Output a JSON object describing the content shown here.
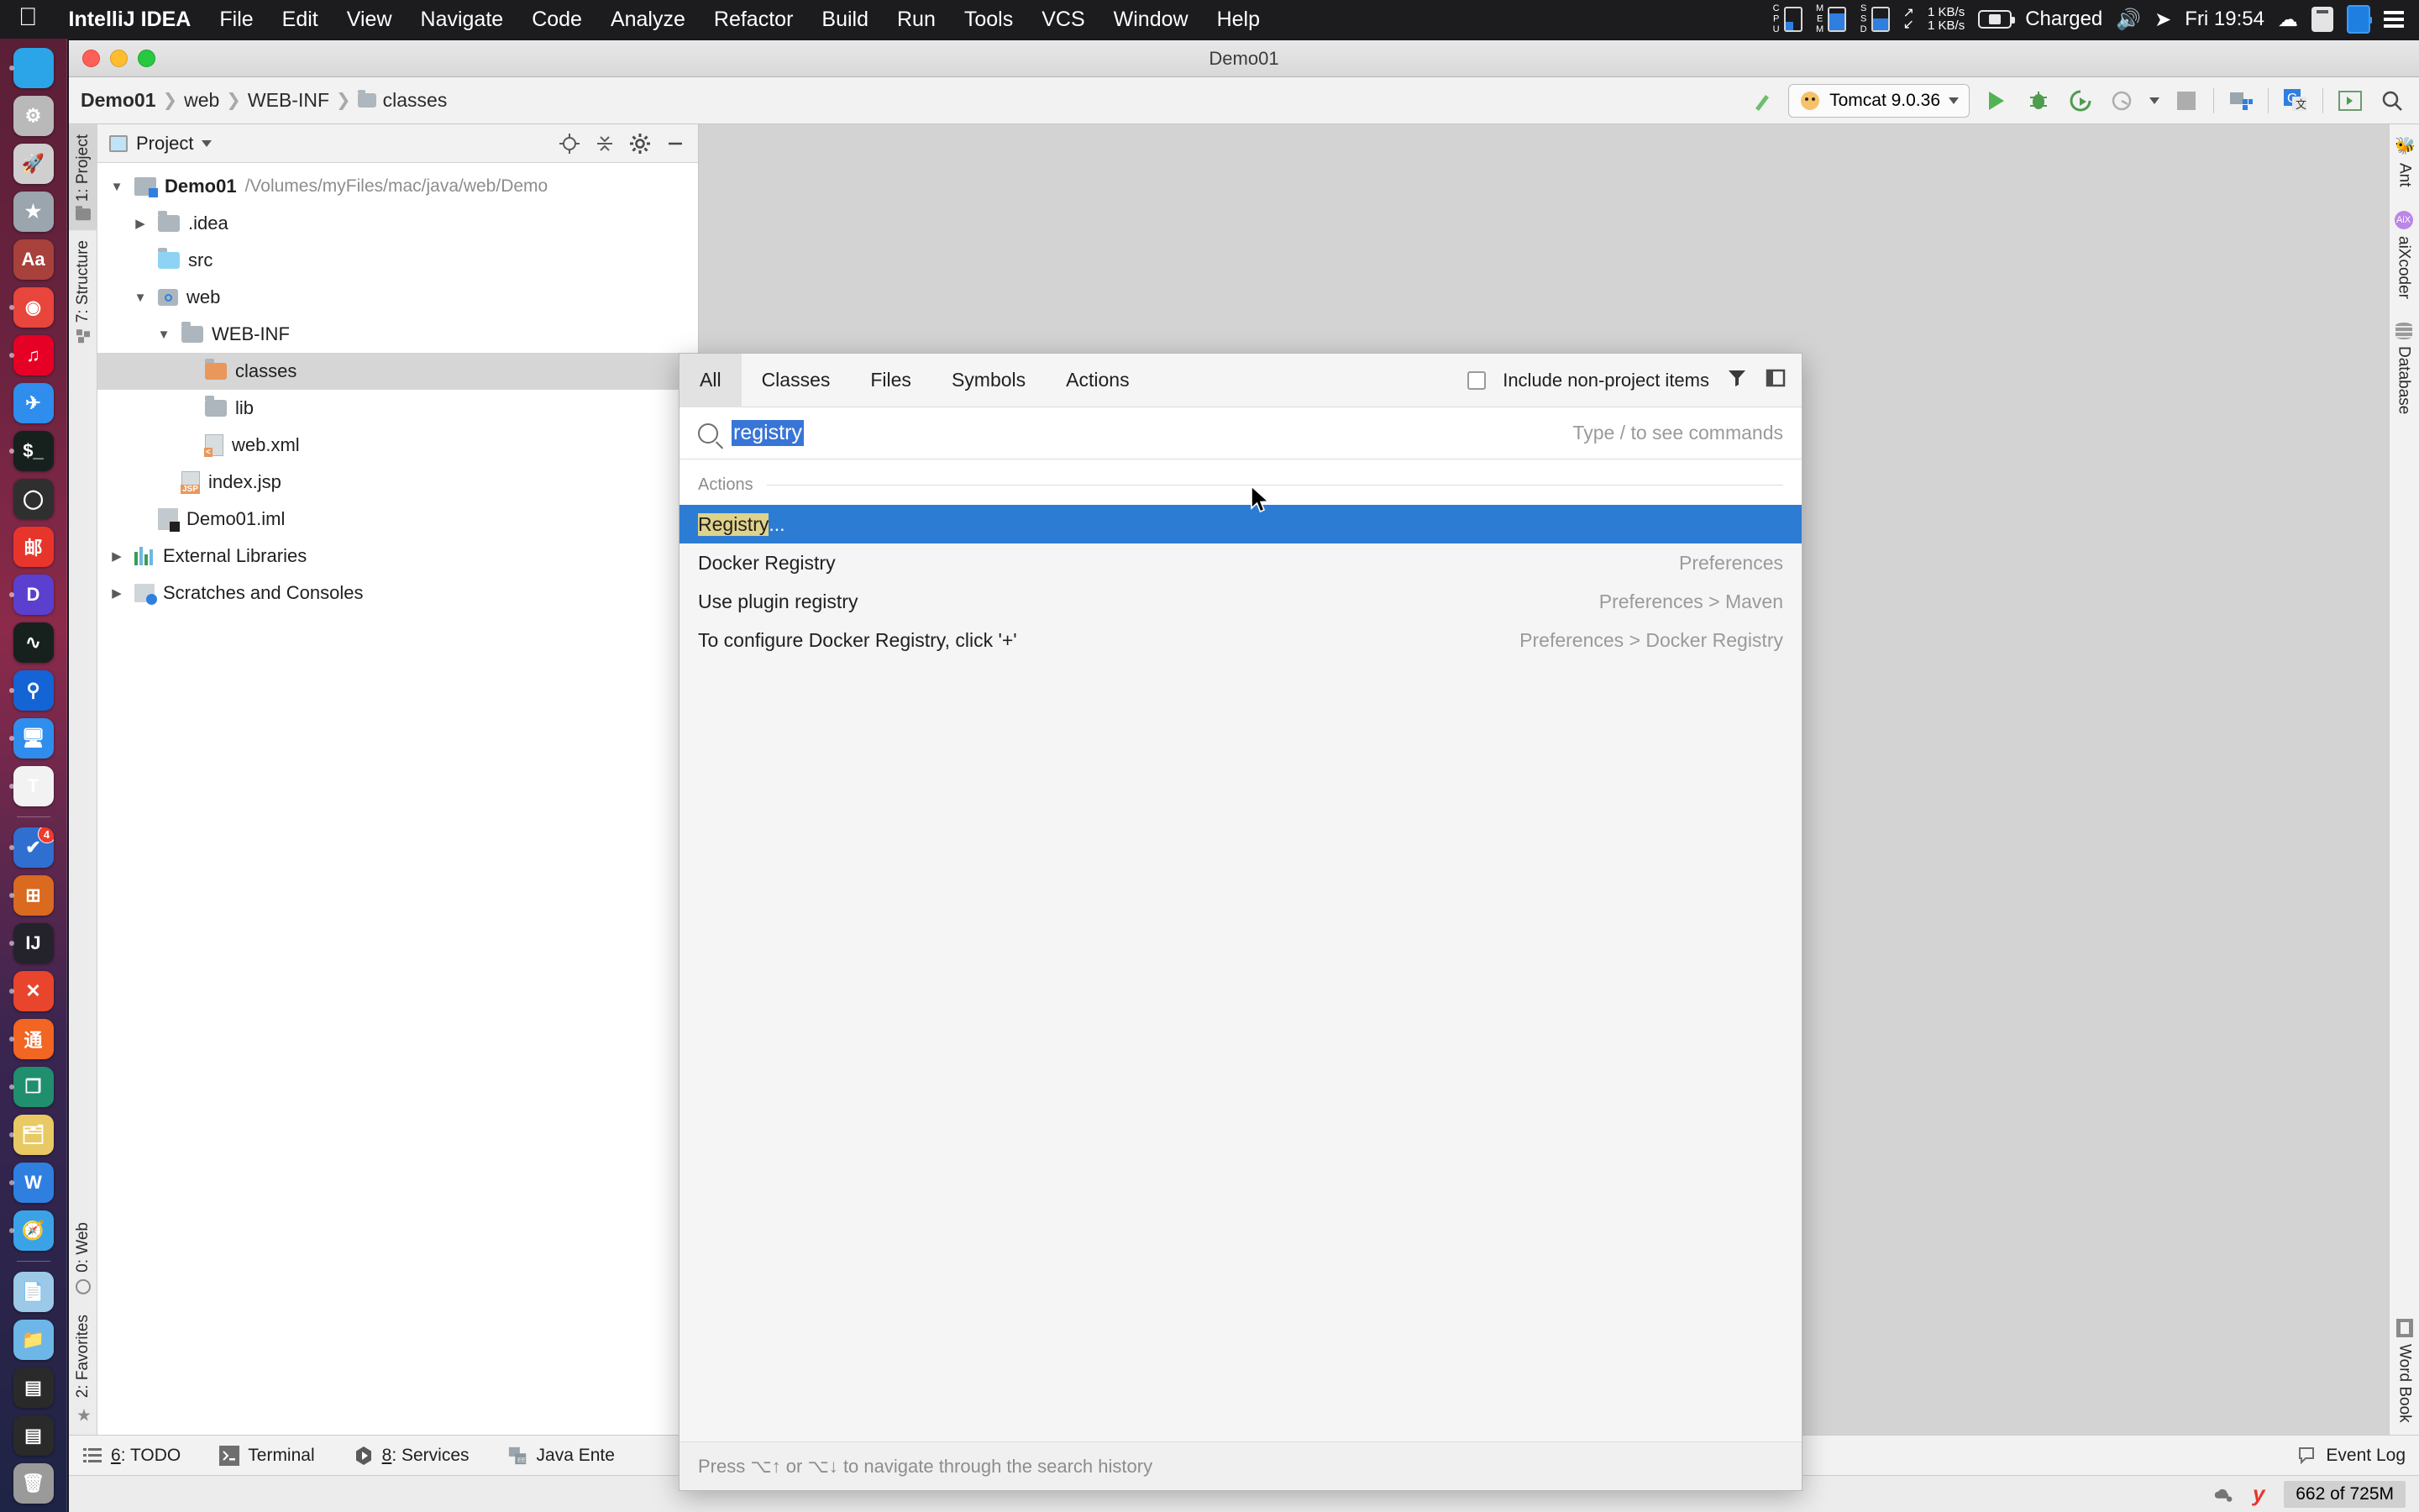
{
  "menubar": {
    "apple_icon": "apple-logo",
    "items": [
      "IntelliJ IDEA",
      "File",
      "Edit",
      "View",
      "Navigate",
      "Code",
      "Analyze",
      "Refactor",
      "Build",
      "Run",
      "Tools",
      "VCS",
      "Window",
      "Help"
    ],
    "status": {
      "cpu_label": "CPU",
      "mem_label": "MEM",
      "ssd_label": "SSD",
      "net_up": "1 KB/s",
      "net_down": "1 KB/s",
      "battery": "Charged",
      "clock": "Fri 19:54"
    }
  },
  "dock": {
    "items": [
      {
        "name": "finder",
        "glyph": "",
        "bg": "#2ba4e8",
        "running": true
      },
      {
        "name": "system-preferences",
        "glyph": "⚙",
        "bg": "#b9b9b9",
        "running": false
      },
      {
        "name": "launchpad",
        "glyph": "🚀",
        "bg": "#cfcfcf",
        "running": false
      },
      {
        "name": "alfred",
        "glyph": "★",
        "bg": "#9aa5ad",
        "running": false
      },
      {
        "name": "dictionary",
        "glyph": "Aa",
        "bg": "#a8413b",
        "running": false
      },
      {
        "name": "google-chrome",
        "glyph": "◉",
        "bg": "#e8453c",
        "running": true
      },
      {
        "name": "netease-music",
        "glyph": "♫",
        "bg": "#e60026",
        "running": true
      },
      {
        "name": "dingtalk",
        "glyph": "✈",
        "bg": "#2f8ded",
        "running": false
      },
      {
        "name": "iterm-terminal",
        "glyph": "$_",
        "bg": "#16211d",
        "running": true
      },
      {
        "name": "wechat-dev",
        "glyph": "◯",
        "bg": "#2f2f2f",
        "running": false
      },
      {
        "name": "mail-cn",
        "glyph": "邮",
        "bg": "#e8352c",
        "running": false
      },
      {
        "name": "dash-docs",
        "glyph": "D",
        "bg": "#5b3fcf",
        "running": true
      },
      {
        "name": "activity-monitor",
        "glyph": "∿",
        "bg": "#16211d",
        "running": false
      },
      {
        "name": "navicat",
        "glyph": "⚲",
        "bg": "#1464d6",
        "running": true
      },
      {
        "name": "parallels-windows",
        "glyph": "🖥",
        "bg": "#2f8ded",
        "running": true
      },
      {
        "name": "typora",
        "glyph": "T",
        "bg": "#f2f2f2",
        "running": true
      },
      {
        "name": "separator",
        "glyph": "",
        "bg": "",
        "running": false
      },
      {
        "name": "things-todo",
        "glyph": "✔",
        "bg": "#2f6fd0",
        "running": true,
        "badge": "4"
      },
      {
        "name": "windows-vm",
        "glyph": "⊞",
        "bg": "#d96a1f",
        "running": true
      },
      {
        "name": "intellij-idea",
        "glyph": "IJ",
        "bg": "#24232b",
        "running": true
      },
      {
        "name": "xmind",
        "glyph": "✕",
        "bg": "#e8452c",
        "running": true
      },
      {
        "name": "tongyi",
        "glyph": "通",
        "bg": "#f26522",
        "running": true
      },
      {
        "name": "snipaste",
        "glyph": "❐",
        "bg": "#1f8f6e",
        "running": true
      },
      {
        "name": "file-manager",
        "glyph": "🗂",
        "bg": "#e8c964",
        "running": true
      },
      {
        "name": "wps-office",
        "glyph": "W",
        "bg": "#2f7fe0",
        "running": true
      },
      {
        "name": "safari",
        "glyph": "🧭",
        "bg": "#3aa3e8",
        "running": true
      },
      {
        "name": "separator",
        "glyph": "",
        "bg": "",
        "running": false
      },
      {
        "name": "downloads-stack",
        "glyph": "📄",
        "bg": "#9cc9e8",
        "running": false
      },
      {
        "name": "documents-folder",
        "glyph": "📁",
        "bg": "#6db7e8",
        "running": false
      },
      {
        "name": "minimized-window-1",
        "glyph": "▤",
        "bg": "#2a2a2a",
        "running": false
      },
      {
        "name": "minimized-window-2",
        "glyph": "▤",
        "bg": "#2a2a2a",
        "running": false
      },
      {
        "name": "trash",
        "glyph": "🗑",
        "bg": "#9a9a9a",
        "running": false
      }
    ]
  },
  "window": {
    "title": "Demo01"
  },
  "toolbar": {
    "breadcrumbs": [
      "Demo01",
      "web",
      "WEB-INF",
      "classes"
    ],
    "run_config": "Tomcat 9.0.36",
    "buttons": [
      "build-hammer",
      "run",
      "debug",
      "run-coverage",
      "profile",
      "stop",
      "project-structure",
      "translate",
      "terminal-toggle",
      "search-everywhere"
    ]
  },
  "left_strip": {
    "top": [
      {
        "label": "1: Project",
        "key": "1",
        "icon": "folder-icon",
        "selected": true
      },
      {
        "label": "7: Structure",
        "key": "7",
        "icon": "structure-icon",
        "selected": false
      }
    ],
    "bottom": [
      {
        "label": "0: Web",
        "key": "0",
        "icon": "globe-icon",
        "selected": false
      },
      {
        "label": "2: Favorites",
        "key": "2",
        "icon": "star-icon",
        "selected": false
      }
    ]
  },
  "right_strip": {
    "top": [
      {
        "label": "Ant",
        "icon": "ant-icon"
      },
      {
        "label": "aiXcoder",
        "icon": "aixcoder-icon"
      },
      {
        "label": "Database",
        "icon": "database-icon"
      }
    ],
    "bottom": [
      {
        "label": "Word Book",
        "icon": "word-book-icon"
      }
    ]
  },
  "project_panel": {
    "title": "Project",
    "header_icons": [
      "locate-icon",
      "collapse-all-icon",
      "settings-gear-icon",
      "hide-icon"
    ],
    "tree": [
      {
        "depth": 0,
        "arrow": "down",
        "icon": "module-icon",
        "label": "Demo01",
        "bold": true,
        "path": "/Volumes/myFiles/mac/java/web/Demo",
        "selected": false
      },
      {
        "depth": 1,
        "arrow": "right",
        "icon": "folder-icon",
        "label": ".idea",
        "bold": false,
        "path": "",
        "selected": false
      },
      {
        "depth": 1,
        "arrow": "none",
        "icon": "source-folder-icon",
        "label": "src",
        "bold": false,
        "path": "",
        "selected": false
      },
      {
        "depth": 1,
        "arrow": "down",
        "icon": "web-folder-icon",
        "label": "web",
        "bold": false,
        "path": "",
        "selected": false
      },
      {
        "depth": 2,
        "arrow": "down",
        "icon": "folder-icon",
        "label": "WEB-INF",
        "bold": false,
        "path": "",
        "selected": false
      },
      {
        "depth": 3,
        "arrow": "none",
        "icon": "output-folder-icon",
        "label": "classes",
        "bold": false,
        "path": "",
        "selected": true
      },
      {
        "depth": 3,
        "arrow": "none",
        "icon": "folder-icon",
        "label": "lib",
        "bold": false,
        "path": "",
        "selected": false
      },
      {
        "depth": 3,
        "arrow": "none",
        "icon": "xml-file-icon",
        "label": "web.xml",
        "bold": false,
        "path": "",
        "selected": false
      },
      {
        "depth": 2,
        "arrow": "none",
        "icon": "jsp-file-icon",
        "label": "index.jsp",
        "bold": false,
        "path": "",
        "selected": false
      },
      {
        "depth": 1,
        "arrow": "none",
        "icon": "iml-file-icon",
        "label": "Demo01.iml",
        "bold": false,
        "path": "",
        "selected": false
      },
      {
        "depth": 0,
        "arrow": "right",
        "icon": "libraries-icon",
        "label": "External Libraries",
        "bold": false,
        "path": "",
        "selected": false
      },
      {
        "depth": 0,
        "arrow": "right",
        "icon": "scratches-icon",
        "label": "Scratches and Consoles",
        "bold": false,
        "path": "",
        "selected": false
      }
    ]
  },
  "search_everywhere": {
    "tabs": [
      {
        "label": "All",
        "active": true
      },
      {
        "label": "Classes",
        "active": false
      },
      {
        "label": "Files",
        "active": false
      },
      {
        "label": "Symbols",
        "active": false
      },
      {
        "label": "Actions",
        "active": false
      }
    ],
    "include_non_project": {
      "label": "Include non-project items",
      "checked": false
    },
    "filter_icon": "filter-funnel-icon",
    "preview_icon": "preview-panel-icon",
    "query": "registry",
    "hint": "Type / to see commands",
    "group_header": "Actions",
    "results": [
      {
        "highlight": "Registry",
        "rest": "...",
        "right": "",
        "selected": true
      },
      {
        "highlight": "",
        "rest": "Docker Registry",
        "right": "Preferences",
        "selected": false
      },
      {
        "highlight": "",
        "rest": "Use plugin registry",
        "right": "Preferences > Maven",
        "selected": false
      },
      {
        "highlight": "",
        "rest": "To configure Docker Registry, click '+'",
        "right": "Preferences > Docker Registry",
        "selected": false
      }
    ],
    "footer": "Press ⌥↑ or ⌥↓ to navigate through the search history"
  },
  "statusbar": {
    "items": [
      {
        "label": "6: TODO",
        "key": "6",
        "icon": "todo-list-icon"
      },
      {
        "label": "Terminal",
        "key": "",
        "icon": "terminal-icon"
      },
      {
        "label": "8: Services",
        "key": "8",
        "icon": "services-icon"
      },
      {
        "label": "Java Ente",
        "key": "",
        "icon": "java-enterprise-icon"
      }
    ],
    "event_log": "Event Log",
    "memory": "662 of 725M",
    "right_icons": [
      "cloud-settings-icon",
      "youdao-icon"
    ]
  }
}
